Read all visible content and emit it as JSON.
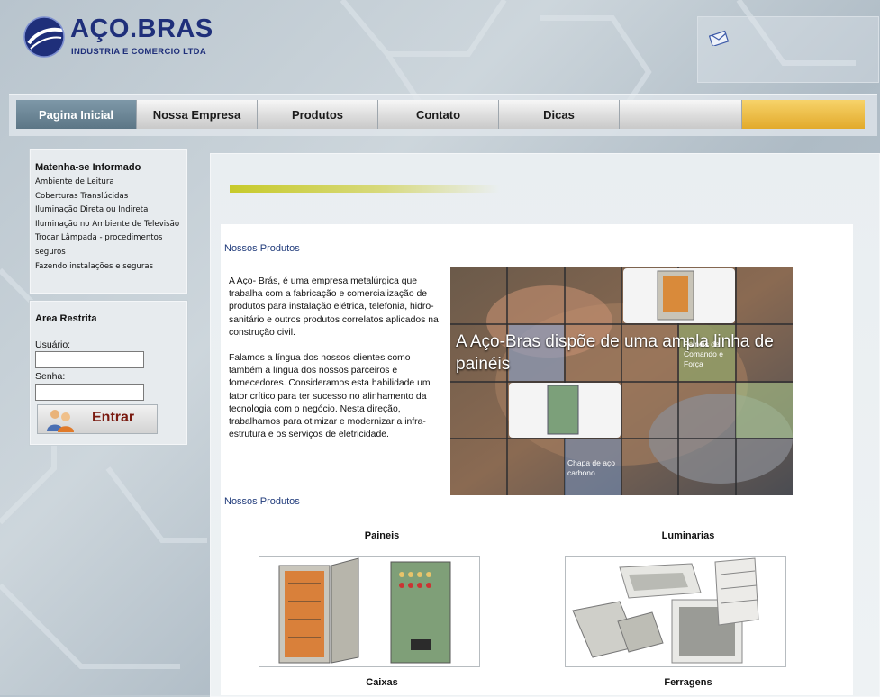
{
  "colors": {
    "brand_blue": "#1f2f7a",
    "nav_active": "#6a8494",
    "accent_gold": "#e9b94a",
    "link_blue": "#1f3a7a",
    "login_red": "#7a1a10"
  },
  "logo": {
    "name": "AÇO.BRAS",
    "subtitle": "INDUSTRIA E COMERCIO LTDA",
    "icon": "globe-logo-icon"
  },
  "header": {
    "mail_icon": "envelope-icon"
  },
  "nav": {
    "items": [
      {
        "label": "Pagina Inicial",
        "active": true
      },
      {
        "label": "Nossa Empresa"
      },
      {
        "label": "Produtos"
      },
      {
        "label": "Contato"
      },
      {
        "label": "Dicas"
      }
    ]
  },
  "sidebar": {
    "info_title": "Matenha-se Informado",
    "links": [
      " Ambiente de Leitura",
      " Coberturas Translúcidas",
      " Iluminação Direta ou Indireta",
      " Iluminação no Ambiente de Televisão",
      " Trocar Lâmpada - procedimentos seguros",
      " Fazendo instalações e seguras"
    ],
    "restricted_title": "Area Restrita",
    "user_label": "Usuário:",
    "password_label": "Senha:",
    "login_label": "Entrar"
  },
  "main": {
    "section_label_1": "Nossos Produtos",
    "intro_p1": "A Aço- Brás, é uma empresa metalúrgica que trabalha com a fabricação e comercialização de produtos para instalação elétrica, telefonia, hidro-sanitário e outros produtos correlatos aplicados na construção civil.",
    "intro_p2": "Falamos a língua dos nossos clientes como também a língua dos nossos parceiros e fornecedores. Consideramos esta habilidade um fator crítico para ter sucesso no alinhamento da tecnologia com o negócio. Nesta direção, trabalhamos para otimizar e modernizar a infra-estrutura e os serviços de eletricidade.",
    "banner_headline": "A Aço-Bras dispõe de uma ampla linha de painéis",
    "banner_caption_1": "Painéis de Comando e Força",
    "banner_caption_2": "Chapa de aço carbono",
    "section_label_2": "Nossos Produtos",
    "products": [
      {
        "title": "Paineis"
      },
      {
        "title": "Luminarias"
      },
      {
        "title": "Caixas"
      },
      {
        "title": "Ferragens"
      }
    ]
  }
}
